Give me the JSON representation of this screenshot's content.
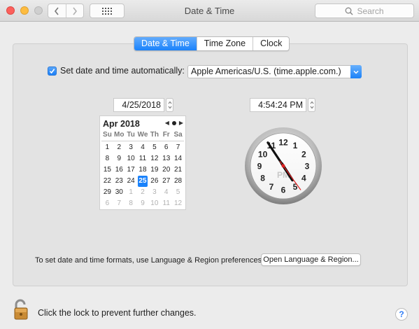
{
  "window": {
    "title": "Date & Time",
    "search_placeholder": "Search"
  },
  "tabs": [
    {
      "label": "Date & Time",
      "active": true
    },
    {
      "label": "Time Zone",
      "active": false
    },
    {
      "label": "Clock",
      "active": false
    }
  ],
  "auto": {
    "checked": true,
    "label": "Set date and time automatically:",
    "server": "Apple Americas/U.S. (time.apple.com.)"
  },
  "date_field": "4/25/2018",
  "time_field": "4:54:24 PM",
  "calendar": {
    "month_label": "Apr 2018",
    "weekdays": [
      "Su",
      "Mo",
      "Tu",
      "We",
      "Th",
      "Fr",
      "Sa"
    ],
    "selected_day": "25",
    "days": [
      {
        "d": "1",
        "other": false
      },
      {
        "d": "2",
        "other": false
      },
      {
        "d": "3",
        "other": false
      },
      {
        "d": "4",
        "other": false
      },
      {
        "d": "5",
        "other": false
      },
      {
        "d": "6",
        "other": false
      },
      {
        "d": "7",
        "other": false
      },
      {
        "d": "8",
        "other": false
      },
      {
        "d": "9",
        "other": false
      },
      {
        "d": "10",
        "other": false
      },
      {
        "d": "11",
        "other": false
      },
      {
        "d": "12",
        "other": false
      },
      {
        "d": "13",
        "other": false
      },
      {
        "d": "14",
        "other": false
      },
      {
        "d": "15",
        "other": false
      },
      {
        "d": "16",
        "other": false
      },
      {
        "d": "17",
        "other": false
      },
      {
        "d": "18",
        "other": false
      },
      {
        "d": "19",
        "other": false
      },
      {
        "d": "20",
        "other": false
      },
      {
        "d": "21",
        "other": false
      },
      {
        "d": "22",
        "other": false
      },
      {
        "d": "23",
        "other": false
      },
      {
        "d": "24",
        "other": false
      },
      {
        "d": "25",
        "other": false
      },
      {
        "d": "26",
        "other": false
      },
      {
        "d": "27",
        "other": false
      },
      {
        "d": "28",
        "other": false
      },
      {
        "d": "29",
        "other": false
      },
      {
        "d": "30",
        "other": false
      },
      {
        "d": "1",
        "other": true
      },
      {
        "d": "2",
        "other": true
      },
      {
        "d": "3",
        "other": true
      },
      {
        "d": "4",
        "other": true
      },
      {
        "d": "5",
        "other": true
      },
      {
        "d": "6",
        "other": true
      },
      {
        "d": "7",
        "other": true
      },
      {
        "d": "8",
        "other": true
      },
      {
        "d": "9",
        "other": true
      },
      {
        "d": "10",
        "other": true
      },
      {
        "d": "11",
        "other": true
      },
      {
        "d": "12",
        "other": true
      }
    ]
  },
  "clock": {
    "numbers": [
      "12",
      "1",
      "2",
      "3",
      "4",
      "5",
      "6",
      "7",
      "8",
      "9",
      "10",
      "11"
    ],
    "period": "PM",
    "hour": 4,
    "minute": 54,
    "second": 24
  },
  "formats": {
    "text": "To set date and time formats, use Language & Region preferences.",
    "button": "Open Language & Region..."
  },
  "lock": {
    "text": "Click the lock to prevent further changes."
  },
  "help_label": "?",
  "colors": {
    "accent": "#1a82fb",
    "second_hand": "#e02020"
  },
  "icons": {
    "back": "chevron-left-icon",
    "forward": "chevron-right-icon",
    "grid": "grid-icon",
    "search": "search-icon",
    "lock": "lock-icon",
    "help": "help-icon"
  }
}
